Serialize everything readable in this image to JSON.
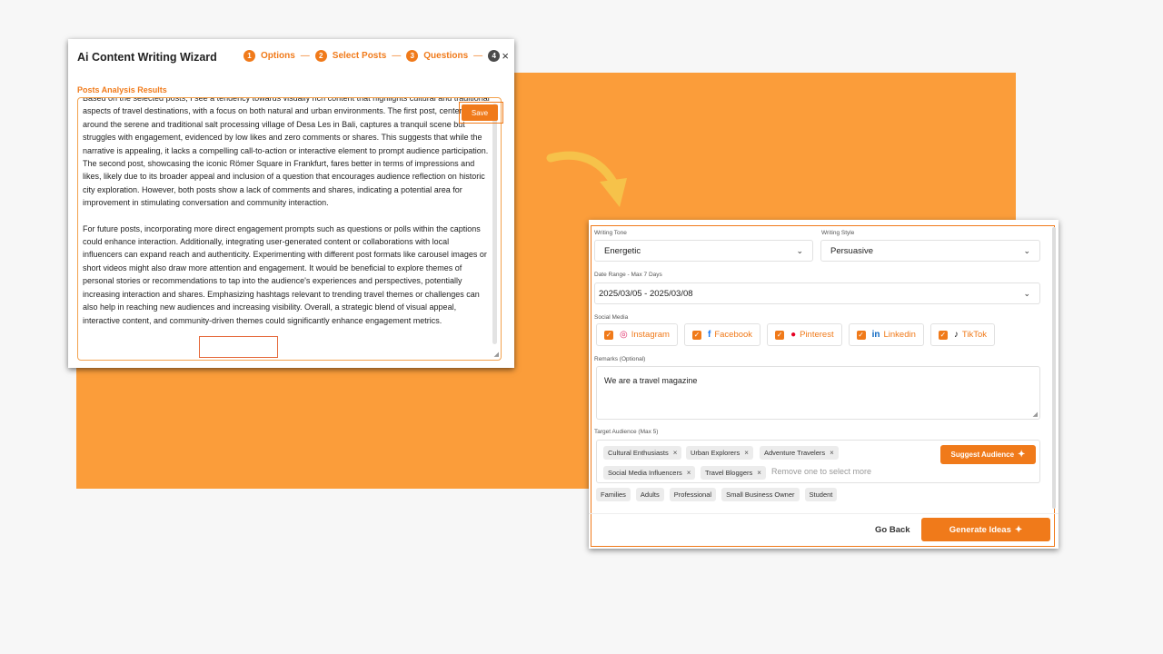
{
  "wizard": {
    "title": "Ai Content Writing Wizard",
    "steps": [
      {
        "num": "1",
        "label": "Options"
      },
      {
        "num": "2",
        "label": "Select Posts"
      },
      {
        "num": "3",
        "label": "Questions"
      },
      {
        "num": "4",
        "label": ""
      }
    ],
    "close": "×",
    "results_label": "Posts Analysis Results",
    "save_label": "Save",
    "paragraph1": "Based on the selected posts, I see a tendency towards visually rich content that highlights cultural and traditional aspects of travel destinations, with a focus on both natural and urban environments. The first post, centered around the serene and traditional salt processing village of Desa Les in Bali, captures a tranquil scene but struggles with engagement, evidenced by low likes and zero comments or shares. This suggests that while the narrative is appealing, it lacks a compelling call-to-action or interactive element to prompt audience participation. The second post, showcasing the iconic Römer Square in Frankfurt, fares better in terms of impressions and likes, likely due to its broader appeal and inclusion of a question that encourages audience reflection on historic city exploration. However, both posts show a lack of comments and shares, indicating a potential area for improvement in stimulating conversation and community interaction.",
    "paragraph2": "For future posts, incorporating more direct engagement prompts such as questions or polls within the captions could enhance interaction. Additionally, integrating user-generated content or collaborations with local influencers can expand reach and authenticity. Experimenting with different post formats like carousel images or short videos might also draw more attention and engagement. It would be beneficial to explore themes of personal stories or recommendations to tap into the audience's experiences and perspectives, potentially increasing interaction and shares. Emphasizing hashtags relevant to trending travel themes or challenges can also help in reaching new audiences and increasing visibility. Overall, a strategic blend of visual appeal, interactive content, and community-driven themes could significantly enhance engagement metrics."
  },
  "form": {
    "writing_tone_label": "Writing Tone",
    "writing_tone_value": "Energetic",
    "writing_style_label": "Writing Style",
    "writing_style_value": "Persuasive",
    "date_range_label": "Date Range - Max 7 Days",
    "date_range_value": "2025/03/05 - 2025/03/08",
    "social_media_label": "Social Media",
    "social_media": [
      {
        "label": "Instagram",
        "icon": "instagram-icon"
      },
      {
        "label": "Facebook",
        "icon": "facebook-icon"
      },
      {
        "label": "Pinterest",
        "icon": "pinterest-icon"
      },
      {
        "label": "Linkedin",
        "icon": "linkedin-icon"
      },
      {
        "label": "TikTok",
        "icon": "tiktok-icon"
      }
    ],
    "remarks_label": "Remarks (Optional)",
    "remarks_value": "We are a travel magazine",
    "audience_label": "Target Audience (Max 5)",
    "audience_selected": [
      "Cultural Enthusiasts",
      "Urban Explorers",
      "Adventure Travelers",
      "Social Media Influencers",
      "Travel Bloggers"
    ],
    "audience_placeholder": "Remove one to select more",
    "suggest_label": "Suggest Audience",
    "audience_options": [
      "Families",
      "Adults",
      "Professional",
      "Small Business Owner",
      "Student"
    ],
    "go_back_label": "Go Back",
    "generate_label": "Generate Ideas"
  },
  "colors": {
    "accent": "#f07a1a",
    "background_panel": "#fb9d3a"
  }
}
